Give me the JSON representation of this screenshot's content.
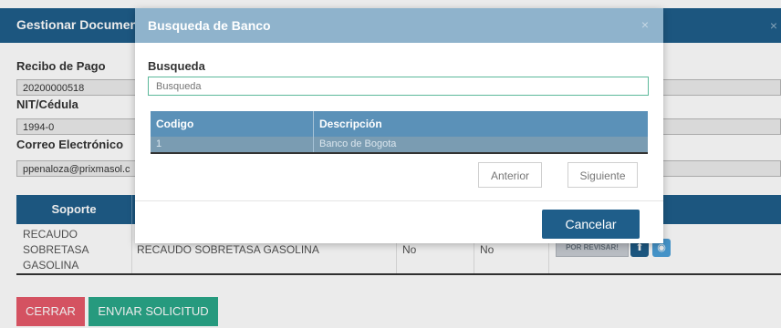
{
  "background": {
    "title": "Gestionar Documen",
    "close_icon": "×",
    "recibo_label": "Recibo de Pago",
    "recibo_value": "20200000518",
    "nit_label": "NIT/Cédula",
    "nit_value": "1994-0",
    "correo_label": "Correo Electrónico",
    "correo_value": "ppenaloza@prixmasol.c",
    "table": {
      "header_soporte": "Soporte",
      "row": {
        "soporte": [
          "RECAUDO",
          "SOBRETASA",
          "GASOLINA"
        ],
        "descripcion": "RECAUDO SOBRETASA GASOLINA",
        "col3": "No",
        "col4": "No",
        "status": "POR REVISAR!"
      }
    },
    "buttons": {
      "cerrar": "CERRAR",
      "enviar": "ENVIAR SOLICITUD"
    }
  },
  "modal": {
    "title": "Busqueda de Banco",
    "close_icon": "×",
    "search_label": "Busqueda",
    "search_placeholder": "Busqueda",
    "results": {
      "headers": [
        "Codigo",
        "Descripción"
      ],
      "rows": [
        {
          "codigo": "1",
          "descripcion": "Banco de Bogota"
        }
      ]
    },
    "pagination": {
      "prev": "Anterior",
      "next": "Siguiente"
    },
    "cancel": "Cancelar"
  },
  "colors": {
    "primary": "#1f5e8a",
    "modal_header": "#8fb3cc",
    "results_header": "#5b91b8",
    "danger": "#e65a6a",
    "success": "#2aa889"
  }
}
